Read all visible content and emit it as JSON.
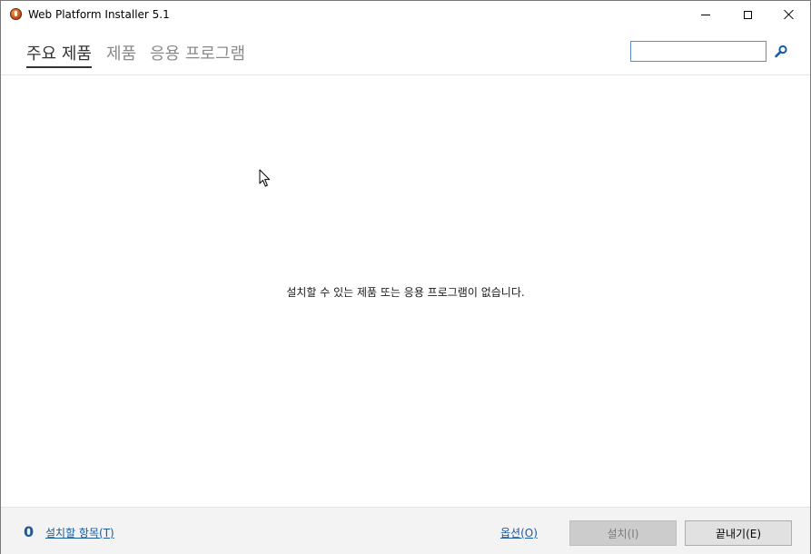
{
  "window": {
    "title": "Web Platform Installer 5.1"
  },
  "nav": {
    "tabs": [
      {
        "label": "주요 제품",
        "active": true
      },
      {
        "label": "제품",
        "active": false
      },
      {
        "label": "응용 프로그램",
        "active": false
      }
    ],
    "search": {
      "value": "",
      "placeholder": ""
    }
  },
  "main": {
    "empty_message": "설치할 수 있는 제품 또는 응용 프로그램이 없습니다."
  },
  "footer": {
    "count": "0",
    "items_link": "설치할 항목(T)",
    "options_link": "옵션(O)",
    "install_label": "설치(I)",
    "exit_label": "끝내기(E)"
  },
  "colors": {
    "accent": "#1a5aa0",
    "active_tab": "#333333",
    "inactive_tab": "#8a8a8a",
    "footer_bg": "#f3f3f3"
  },
  "icons": {
    "app": "web-platform-installer-icon",
    "search": "search-icon",
    "minimize": "minimize-icon",
    "maximize": "maximize-icon",
    "close": "close-icon"
  }
}
